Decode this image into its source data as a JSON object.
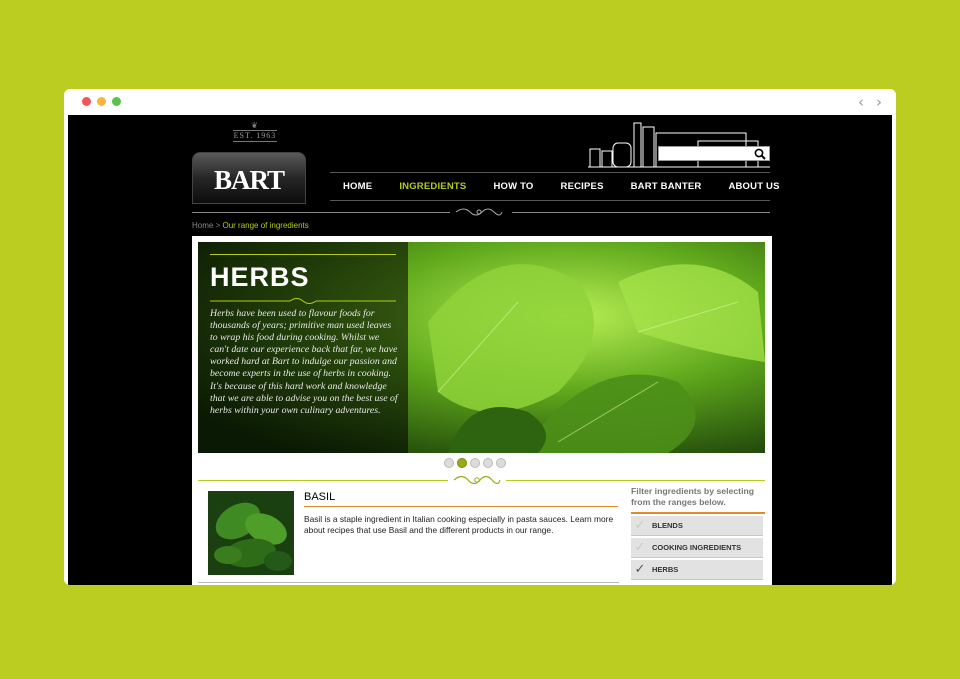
{
  "site": {
    "est": "EST. 1963",
    "logo": "BART",
    "search_placeholder": ""
  },
  "nav": [
    {
      "label": "HOME",
      "active": false
    },
    {
      "label": "INGREDIENTS",
      "active": true
    },
    {
      "label": "HOW TO",
      "active": false
    },
    {
      "label": "RECIPES",
      "active": false
    },
    {
      "label": "BART BANTER",
      "active": false
    },
    {
      "label": "ABOUT US",
      "active": false
    }
  ],
  "breadcrumb": {
    "home": "Home",
    "separator": ">",
    "current": "Our range of ingredients"
  },
  "hero": {
    "title": "HERBS",
    "text": "Herbs have been used to flavour foods for thousands of years; primitive man used leaves to wrap his food during cooking. Whilst we can't date our experience back that far, we have worked hard at Bart to indulge our passion and become experts in the use of herbs in cooking. It's because of this hard work and knowledge that we are able to advise you on the best use of herbs within your own culinary adventures.",
    "slides": 5,
    "active_slide": 2
  },
  "ingredient": {
    "name": "BASIL",
    "description": "Basil is a staple ingredient in Italian cooking especially in pasta sauces. Learn more about recipes that use Basil and the different products in our range."
  },
  "filter": {
    "title": "Filter ingredients by selecting from the ranges below.",
    "items": [
      {
        "label": "BLENDS",
        "checked": false
      },
      {
        "label": "COOKING INGREDIENTS",
        "checked": false
      },
      {
        "label": "HERBS",
        "checked": true
      }
    ]
  },
  "colors": {
    "accent": "#b5cc1d",
    "page_bg": "#bccd22",
    "orange": "#e08a2a"
  }
}
